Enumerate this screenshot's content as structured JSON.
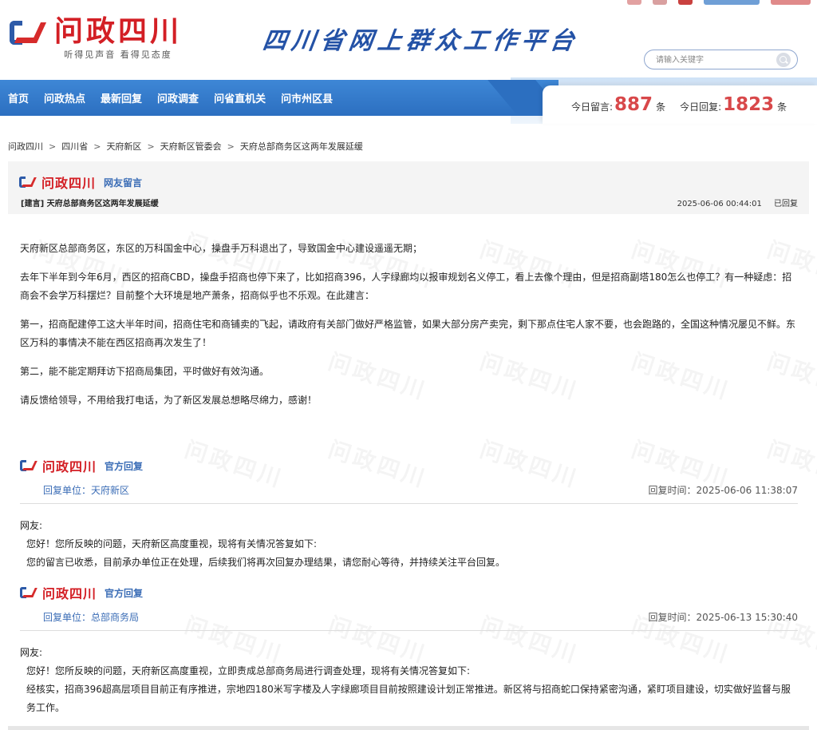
{
  "site": {
    "logo_title": "问政四川",
    "logo_subtitle": "听得见声音  看得见态度",
    "slogan": "四川省网上群众工作平台"
  },
  "search": {
    "placeholder": "请输入关键字"
  },
  "nav": {
    "items": [
      "首页",
      "问政热点",
      "最新回复",
      "问政调查",
      "问省直机关",
      "问市州区县"
    ]
  },
  "stats": {
    "today_messages_label": "今日留言:",
    "today_messages_value": "887",
    "today_replies_label": "今日回复:",
    "today_replies_value": "1823",
    "unit": "条"
  },
  "breadcrumb": [
    "问政四川",
    "四川省",
    "天府新区",
    "天府新区管委会",
    "天府总部商务区这两年发展延缓"
  ],
  "post": {
    "section_label": "网友留言",
    "title": "[建言] 天府总部商务区这两年发展延缓",
    "datetime": "2025-06-06 00:44:01",
    "status": "已回复",
    "paragraphs": [
      "天府新区总部商务区，东区的万科国金中心，操盘手万科退出了，导致国金中心建设遥遥无期；",
      "去年下半年到今年6月，西区的招商CBD，操盘手招商也停下来了，比如招商396，人字绿廊均以报审规划名义停工，看上去像个理由，但是招商副塔180怎么也停工？有一种疑虑：招商会不会学万科摆烂？目前整个大环境是地产萧条，招商似乎也不乐观。在此建言：",
      "第一，招商配建停工这大半年时间，招商住宅和商铺卖的飞起，请政府有关部门做好严格监管，如果大部分房产卖完，剩下那点住宅人家不要，也会跑路的，全国这种情况屡见不鲜。东区万科的事情决不能在西区招商再次发生了！",
      "第二，能不能定期拜访下招商局集团，平时做好有效沟通。",
      "请反馈给领导，不用给我打电话，为了新区发展总想略尽绵力，感谢！"
    ]
  },
  "replies": [
    {
      "tag": "官方回复",
      "unit": "回复单位：天府新区",
      "time": "回复时间：2025-06-06 11:38:07",
      "greeting": "网友:",
      "lines": [
        "您好！您所反映的问题，天府新区高度重视，现将有关情况答复如下:",
        "您的留言已收悉，目前承办单位正在处理，后续我们将再次回复办理结果，请您耐心等待，并持续关注平台回复。"
      ]
    },
    {
      "tag": "官方回复",
      "unit": "回复单位：总部商务局",
      "time": "回复时间：2025-06-13 15:30:40",
      "greeting": "网友:",
      "lines": [
        "  您好！您所反映的问题，天府新区高度重视，立即责成总部商务局进行调查处理，现将有关情况答复如下:",
        "  经核实，招商396超高层项目目前正有序推进，宗地四180米写字楼及人字绿廊项目目前按照建设计划正常推进。新区将与招商蛇口保持紧密沟通，紧盯项目建设，切实做好监督与服务工作。"
      ]
    }
  ],
  "colors": {
    "brand_red": "#d31f25",
    "brand_blue": "#2c6fc0",
    "stat_red": "#d8484a",
    "link_blue": "#3b6db6"
  }
}
